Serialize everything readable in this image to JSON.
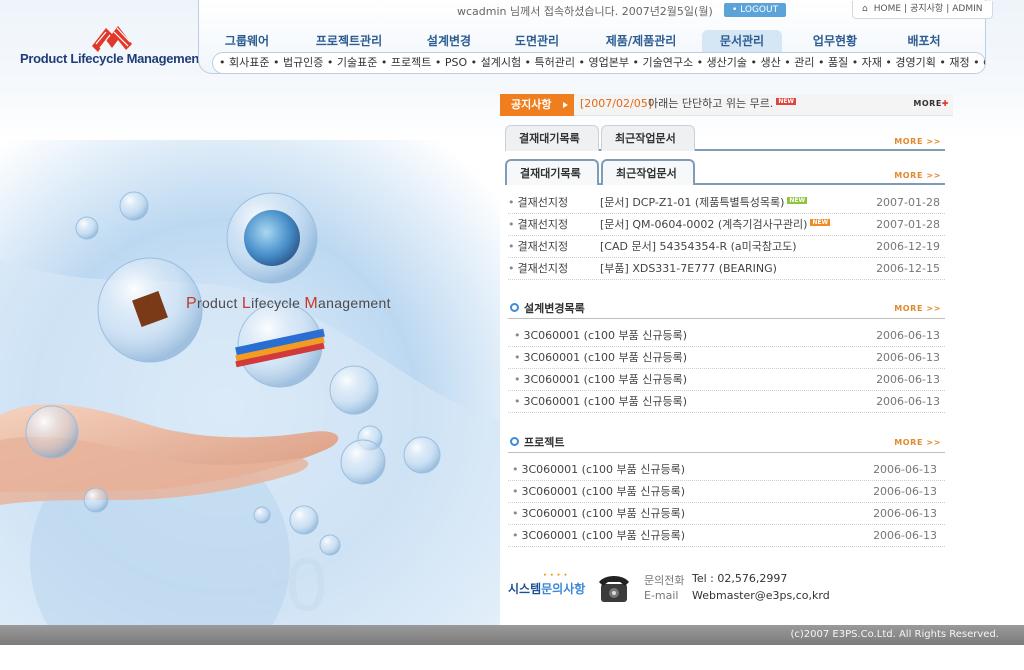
{
  "brand": {
    "name": "Product Lifecycle Management"
  },
  "header": {
    "welcome": "wcadmin 님께서 접속하셨습니다. 2007년2월5일(월)",
    "logout": "LOGOUT",
    "links": {
      "home": "HOME",
      "sitemap": "공지사항",
      "admin": "ADMIN"
    }
  },
  "menu": [
    "그룹웨어",
    "프로젝트관리",
    "설계변경",
    "도면관리",
    "제품/제품관리",
    "문서관리",
    "업무현황",
    "배포처"
  ],
  "active_menu": "문서관리",
  "submenu": "• 회사표준 • 법규인증 • 기술표준 • 프로젝트 • PSO • 설계시험 • 특허관리 • 영업본부 • 기술연구소 • 생산기술 • 생산 • 관리 • 품질 • 자재 • 경영기획 • 재정 • GW",
  "visual": {
    "title_parts": [
      "P",
      "roduct ",
      "L",
      "ifecycle ",
      "M",
      "anagement"
    ]
  },
  "notice": {
    "tag": "공지사항",
    "date": "[2007/02/05]",
    "text": "아래는 단단하고 위는 무르.",
    "badge": "NEW",
    "more": "MORE"
  },
  "tabs_top": {
    "tab1": "결재대기목록",
    "tab2": "최근작업문서",
    "more": "MORE >>"
  },
  "tabs_main": {
    "tab1": "결재대기목록",
    "tab2": "최근작업문서",
    "more": "MORE >>"
  },
  "approval_list": [
    {
      "status": "결재선지정",
      "title": "[문서] DCP-Z1-01 (제품특별특성목록)",
      "badge": "NEW",
      "date": "2007-01-28"
    },
    {
      "status": "결재선지정",
      "title": "[문서] QM-0604-0002 (계측기검사구관리)",
      "badge": "NEW",
      "date": "2007-01-28"
    },
    {
      "status": "결재선지정",
      "title": "[CAD 문서] 54354354-R (a미국참고도)",
      "badge": "",
      "date": "2006-12-19"
    },
    {
      "status": "결재선지정",
      "title": "[부품] XDS331-7E777 (BEARING)",
      "badge": "",
      "date": "2006-12-15"
    }
  ],
  "design_change": {
    "title": "설계변경목록",
    "more": "MORE >>",
    "items": [
      {
        "text": "3C060001 (c100 부품 신규등록)",
        "date": "2006-06-13"
      },
      {
        "text": "3C060001 (c100 부품 신규등록)",
        "date": "2006-06-13"
      },
      {
        "text": "3C060001 (c100 부품 신규등록)",
        "date": "2006-06-13"
      },
      {
        "text": "3C060001 (c100 부품 신규등록)",
        "date": "2006-06-13"
      }
    ]
  },
  "project": {
    "title": "프로젝트",
    "more": "MORE >>",
    "items": [
      {
        "text": "3C060001 (c100 부품 신규등록)",
        "date": "2006-06-13"
      },
      {
        "text": "3C060001 (c100 부품 신규등록)",
        "date": "2006-06-13"
      },
      {
        "text": "3C060001 (c100 부품 신규등록)",
        "date": "2006-06-13"
      },
      {
        "text": "3C060001 (c100 부품 신규등록)",
        "date": "2006-06-13"
      }
    ]
  },
  "contact": {
    "title_a": "시스템",
    "title_b": "문의사항",
    "dots": "••••",
    "phone_label": "문의전화",
    "phone": "Tel : 02,576,2997",
    "email_label": "E-mail",
    "email": "Webmaster@e3ps,co,krd"
  },
  "footer": {
    "copyright": "(c)2007 E3PS.Co.Ltd. All Rights Reserved."
  },
  "colors": {
    "accent": "#f07d1e",
    "menu": "#2d5c92",
    "link_blue": "#2f6db5",
    "new_badge": "#e0443a"
  }
}
